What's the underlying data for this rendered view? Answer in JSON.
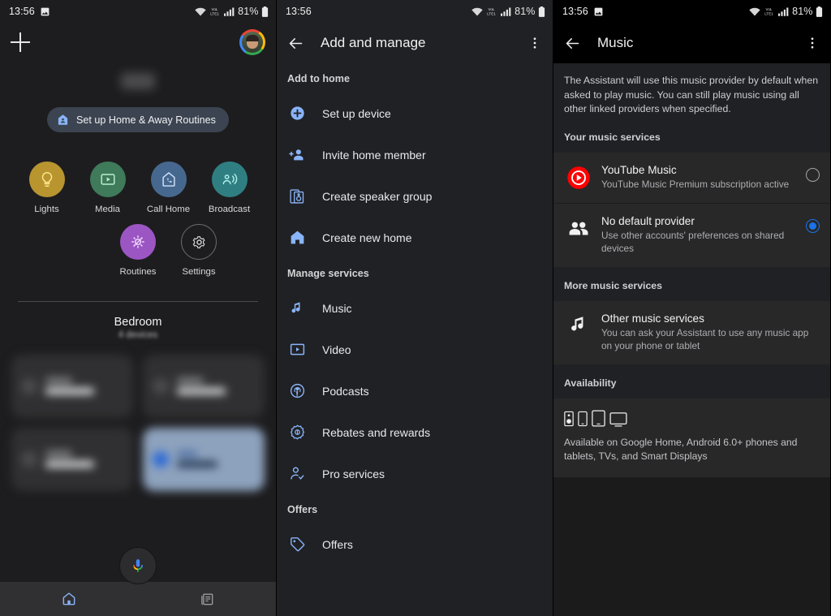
{
  "status_bar": {
    "time": "13:56",
    "battery_percent": "81%",
    "icons": [
      "image-icon",
      "wifi-icon",
      "volte-icon",
      "signal-icon",
      "battery-icon"
    ],
    "volte_label": "VoLTE"
  },
  "panel_home": {
    "add_button": "add-icon",
    "avatar": "account-avatar",
    "routine_chip": {
      "label": "Set up Home & Away Routines",
      "icon": "home-person-icon"
    },
    "shortcuts": [
      {
        "label": "Lights",
        "icon": "lightbulb-icon",
        "color": "#b8952f"
      },
      {
        "label": "Media",
        "icon": "media-play-icon",
        "color": "#3f7a5a"
      },
      {
        "label": "Call Home",
        "icon": "call-home-icon",
        "color": "#46688f"
      },
      {
        "label": "Broadcast",
        "icon": "broadcast-icon",
        "color": "#2f7f82"
      },
      {
        "label": "Routines",
        "icon": "routines-icon",
        "color": "#9c56c3"
      },
      {
        "label": "Settings",
        "icon": "gear-icon",
        "color": "transparent"
      }
    ],
    "room": {
      "name": "Bedroom",
      "subtitle": "4 devices"
    },
    "devices": [
      {
        "state": "off"
      },
      {
        "state": "off"
      },
      {
        "state": "off"
      },
      {
        "state": "on"
      }
    ],
    "mic_fab": "assistant-mic-icon",
    "bottom_nav": [
      {
        "label": "Home",
        "icon": "home-icon",
        "active": true
      },
      {
        "label": "Feed",
        "icon": "feed-icon",
        "active": false
      }
    ]
  },
  "panel_add_manage": {
    "title": "Add and manage",
    "back": "back-arrow-icon",
    "overflow": "more-vert-icon",
    "sections": [
      {
        "header": "Add to home",
        "items": [
          {
            "label": "Set up device",
            "icon": "add-circle-icon"
          },
          {
            "label": "Invite home member",
            "icon": "person-add-icon"
          },
          {
            "label": "Create speaker group",
            "icon": "speaker-group-icon"
          },
          {
            "label": "Create new home",
            "icon": "home-icon"
          }
        ]
      },
      {
        "header": "Manage services",
        "items": [
          {
            "label": "Music",
            "icon": "music-note-icon"
          },
          {
            "label": "Video",
            "icon": "video-icon"
          },
          {
            "label": "Podcasts",
            "icon": "podcast-icon"
          },
          {
            "label": "Rebates and rewards",
            "icon": "rebates-icon"
          },
          {
            "label": "Pro services",
            "icon": "pro-services-icon"
          }
        ]
      },
      {
        "header": "Offers",
        "items": [
          {
            "label": "Offers",
            "icon": "tag-icon"
          }
        ]
      }
    ]
  },
  "panel_music": {
    "title": "Music",
    "back": "back-arrow-icon",
    "overflow": "more-vert-icon",
    "description": "The Assistant will use this music provider by default when asked to play music. You can still play music using all other linked providers when specified.",
    "your_services_header": "Your music services",
    "providers": [
      {
        "name": "YouTube Music",
        "subtitle": "YouTube Music Premium subscription active",
        "icon": "youtube-music-icon",
        "selected": false
      },
      {
        "name": "No default provider",
        "subtitle": "Use other accounts' preferences on shared devices",
        "icon": "people-icon",
        "selected": true
      }
    ],
    "more_services_header": "More music services",
    "other_services": {
      "name": "Other music services",
      "subtitle": "You can ask your Assistant to use any music app on your phone or tablet",
      "icon": "music-note-icon"
    },
    "availability_header": "Availability",
    "availability_text": "Available on Google Home, Android 6.0+ phones and tablets, TVs, and Smart Displays",
    "availability_icons": [
      "speaker-icon",
      "phone-icon",
      "tablet-icon",
      "tv-icon"
    ]
  },
  "colors": {
    "accent_blue": "#8ab4f8",
    "selected_blue": "#1a73e8",
    "youtube_red": "#ff0000"
  }
}
